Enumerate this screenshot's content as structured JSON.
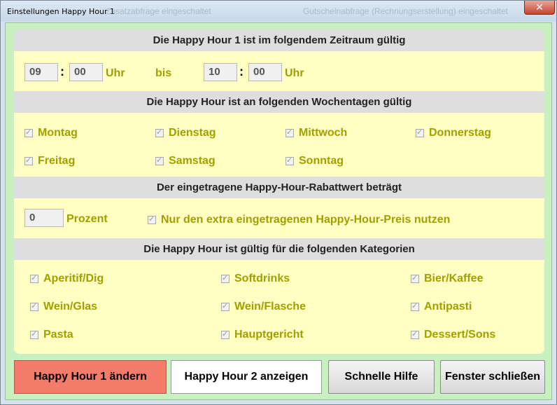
{
  "window": {
    "title": "Einstellungen Happy Hour 1",
    "ghost_left": "Zusatzabfrage eingeschaltet",
    "ghost_right": "Gutscheinabfrage (Rechnungserstellung) eingeschaltet",
    "close_glyph": "✕"
  },
  "time": {
    "header": "Die Happy Hour 1 ist im folgendem Zeitraum gültig",
    "from_hour": "09",
    "from_minute": "00",
    "unit_from": "Uhr",
    "separator": "bis",
    "to_hour": "10",
    "to_minute": "00",
    "unit_to": "Uhr",
    "colon": ":"
  },
  "weekdays": {
    "header": "Die Happy Hour ist an folgenden Wochentagen gültig",
    "items": [
      {
        "label": "Montag",
        "checked": true
      },
      {
        "label": "Dienstag",
        "checked": true
      },
      {
        "label": "Mittwoch",
        "checked": true
      },
      {
        "label": "Donnerstag",
        "checked": true
      },
      {
        "label": "Freitag",
        "checked": true
      },
      {
        "label": "Samstag",
        "checked": true
      },
      {
        "label": "Sonntag",
        "checked": true
      }
    ]
  },
  "discount": {
    "header": "Der eingetragene Happy-Hour-Rabattwert beträgt",
    "value": "0",
    "unit": "Prozent",
    "extra_price_label": "Nur den extra eingetragenen Happy-Hour-Preis nutzen",
    "extra_price_checked": true
  },
  "categories": {
    "header": "Die Happy Hour ist gültig für die folgenden Kategorien",
    "items": [
      {
        "label": "Aperitif/Dig",
        "checked": true
      },
      {
        "label": "Softdrinks",
        "checked": true
      },
      {
        "label": "Bier/Kaffee",
        "checked": true
      },
      {
        "label": "Wein/Glas",
        "checked": true
      },
      {
        "label": "Wein/Flasche",
        "checked": true
      },
      {
        "label": "Antipasti",
        "checked": true
      },
      {
        "label": "Pasta",
        "checked": true
      },
      {
        "label": "Hauptgericht",
        "checked": true
      },
      {
        "label": "Dessert/Sons",
        "checked": true
      }
    ]
  },
  "buttons": {
    "change_hh1": "Happy Hour 1 ändern",
    "show_hh2": "Happy Hour 2 anzeigen",
    "quick_help": "Schnelle Hilfe",
    "close_window": "Fenster schließen"
  },
  "checkmark_glyph": "✓",
  "colors": {
    "client_bg": "#c9f0c0",
    "panel_bg": "#ffffc4",
    "section_header_bg": "#dedede",
    "label_olive": "#a0a000",
    "active_button": "#f57b6a"
  }
}
